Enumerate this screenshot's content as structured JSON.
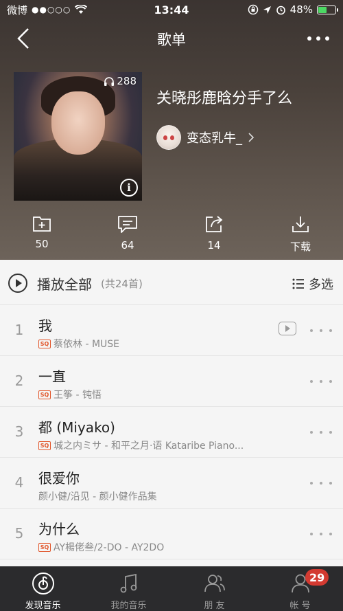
{
  "status_bar": {
    "carrier": "微博",
    "time": "13:44",
    "battery": "48%",
    "battery_level": 0.48
  },
  "nav": {
    "title": "歌单"
  },
  "playlist": {
    "title": "关晓彤鹿晗分手了么",
    "play_count": "288",
    "creator": "变态乳牛_"
  },
  "actions": [
    {
      "icon": "add-folder-icon",
      "label": "50"
    },
    {
      "icon": "comment-icon",
      "label": "64"
    },
    {
      "icon": "share-icon",
      "label": "14"
    },
    {
      "icon": "download-icon",
      "label": "下载"
    }
  ],
  "list_header": {
    "play_all": "播放全部",
    "count": "(共24首)",
    "multi_select": "多选"
  },
  "songs": [
    {
      "index": "1",
      "name": "我",
      "artist": "蔡依林 - MUSE",
      "sq": true,
      "mv": true
    },
    {
      "index": "2",
      "name": "一直",
      "artist": "王筝 - 钝悟",
      "sq": true,
      "mv": false
    },
    {
      "index": "3",
      "name": "都 (Miyako)",
      "artist": "城之内ミサ - 和平之月·语 Kataribe Piano...",
      "sq": true,
      "mv": false
    },
    {
      "index": "4",
      "name": "很爱你",
      "artist": "颜小健/沿见 - 颜小健作品集",
      "sq": false,
      "mv": false
    },
    {
      "index": "5",
      "name": "为什么",
      "artist": "AY楊佬叁/2-DO - AY2DO",
      "sq": true,
      "mv": false
    }
  ],
  "sq_label": "SQ",
  "tabs": [
    {
      "label": "发现音乐",
      "icon": "netease-logo-icon",
      "active": true
    },
    {
      "label": "我的音乐",
      "icon": "music-note-icon",
      "active": false
    },
    {
      "label": "朋 友",
      "icon": "friends-icon",
      "active": false
    },
    {
      "label": "帐 号",
      "icon": "account-icon",
      "active": false,
      "badge": "29"
    }
  ],
  "colors": {
    "accent": "#d33a31",
    "sq": "#e1562b",
    "tabbar": "#2b2b2d"
  }
}
